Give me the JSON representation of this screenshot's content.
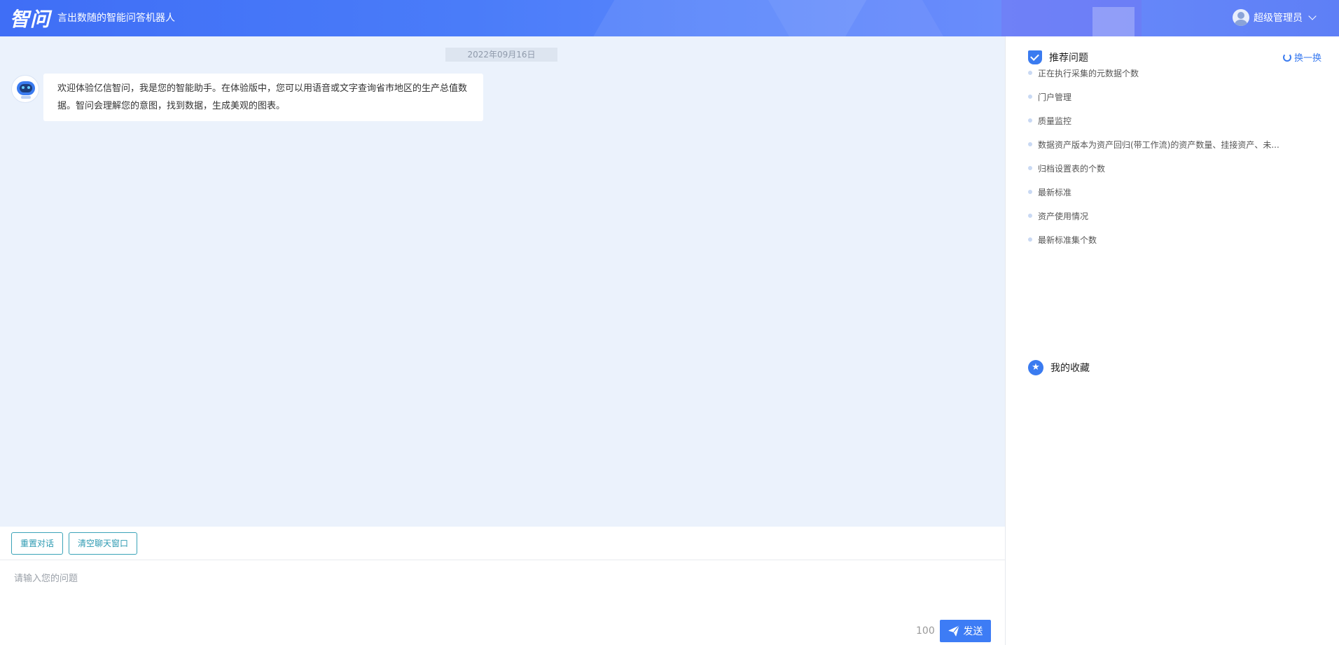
{
  "header": {
    "logo": "智问",
    "slogan": "言出数随的智能问答机器人",
    "user_name": "超级管理员"
  },
  "chat": {
    "date": "2022年09月16日",
    "bot_message": "欢迎体验亿信智问，我是您的智能助手。在体验版中，您可以用语音或文字查询省市地区的生产总值数据。智问会理解您的意图，找到数据，生成美观的图表。"
  },
  "toolbar": {
    "reset_label": "重置对话",
    "clear_label": "清空聊天窗口"
  },
  "input": {
    "placeholder": "请输入您的问题",
    "char_count": "100",
    "send_label": "发送"
  },
  "panel": {
    "recommend_title": "推荐问题",
    "refresh_label": "换一换",
    "questions": [
      "正在执行采集的元数据个数",
      "门户管理",
      "质量监控",
      "数据资产版本为资产回归(带工作流)的资产数量、挂接资产、未...",
      "归档设置表的个数",
      "最新标准",
      "资产使用情况",
      "最新标准集个数"
    ],
    "favorites_title": "我的收藏"
  },
  "colors": {
    "accent": "#3d7cf5",
    "chat_bg": "#ebf2fc",
    "outline_button": "#2d9ab2"
  }
}
